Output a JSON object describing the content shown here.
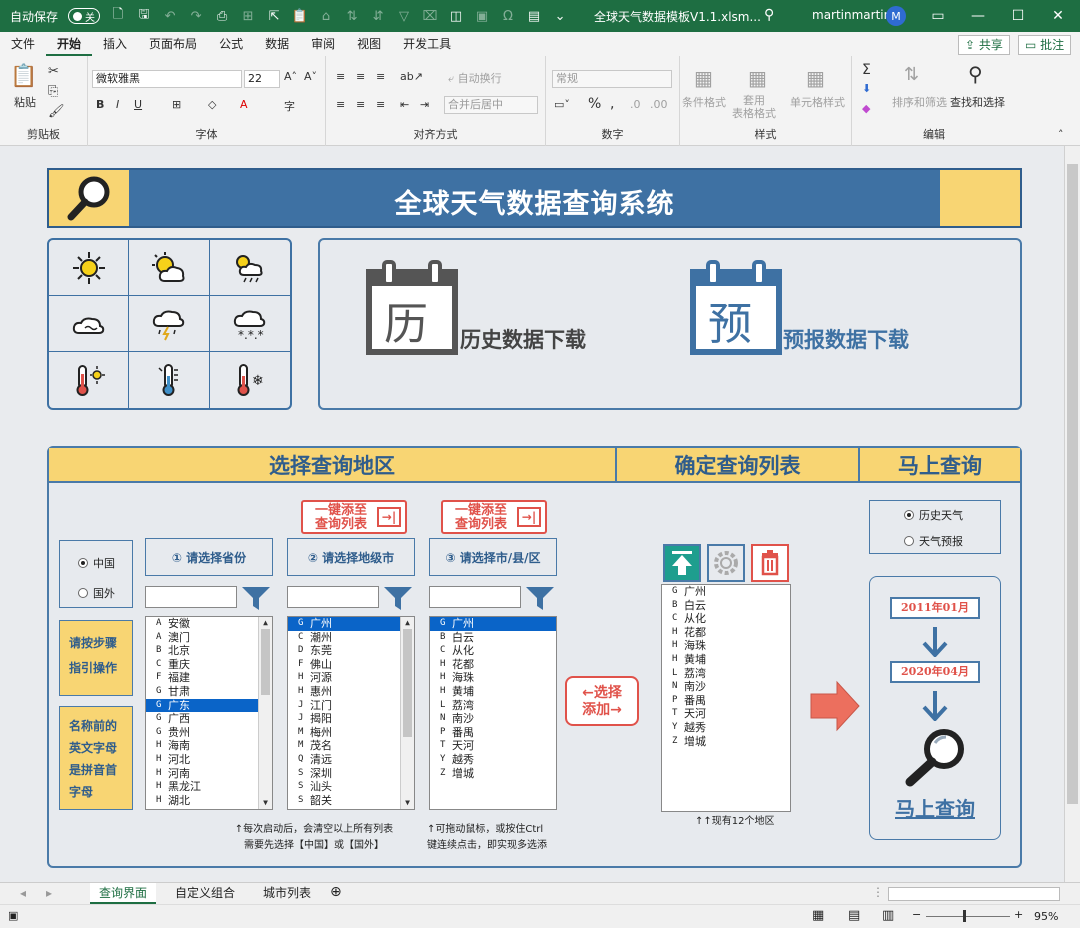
{
  "titlebar": {
    "autosave_label": "自动保存",
    "autosave_state": "关",
    "doc_title": "全球天气数据模板V1.1.xlsm...",
    "user_name": "martinmartin",
    "user_initial": "M"
  },
  "menu": {
    "items": [
      "文件",
      "开始",
      "插入",
      "页面布局",
      "公式",
      "数据",
      "审阅",
      "视图",
      "开发工具"
    ],
    "share_label": "共享",
    "comment_label": "批注"
  },
  "ribbon": {
    "clipboard": {
      "paste": "粘贴",
      "group": "剪贴板"
    },
    "font": {
      "name": "微软雅黑",
      "size": "22",
      "group": "字体"
    },
    "align": {
      "wrap": "自动换行",
      "merge": "合并后居中",
      "group": "对齐方式"
    },
    "number": {
      "format": "常规",
      "group": "数字"
    },
    "styles": {
      "cond": "条件格式",
      "table": "套用\n表格格式",
      "cell": "单元格样式",
      "group": "样式"
    },
    "edit": {
      "sort": "排序和筛选",
      "find": "查找和选择",
      "group": "编辑"
    }
  },
  "sheet": {
    "title": "全球天气数据查询系统",
    "history_icon_char": "历",
    "history_label": "历史数据下载",
    "forecast_icon_char": "预",
    "forecast_label": "预报数据下载",
    "hdr_region": "选择查询地区",
    "hdr_list": "确定查询列表",
    "hdr_query": "马上查询",
    "add_all_label": "一键添至\n查询列表",
    "region_options": {
      "china": "中国",
      "abroad": "国外"
    },
    "guide_box": "请按步骤\n指引操作",
    "pinyin_box": "名称前的\n英文字母\n是拼音首\n字母",
    "step1": "① 请选择省份",
    "step2": "② 请选择地级市",
    "step3": "③ 请选择市/县/区",
    "provinces": [
      {
        "k": "A",
        "n": "安徽"
      },
      {
        "k": "A",
        "n": "澳门"
      },
      {
        "k": "B",
        "n": "北京"
      },
      {
        "k": "C",
        "n": "重庆"
      },
      {
        "k": "F",
        "n": "福建"
      },
      {
        "k": "G",
        "n": "甘肃"
      },
      {
        "k": "G",
        "n": "广东",
        "sel": true
      },
      {
        "k": "G",
        "n": "广西"
      },
      {
        "k": "G",
        "n": "贵州"
      },
      {
        "k": "H",
        "n": "海南"
      },
      {
        "k": "H",
        "n": "河北"
      },
      {
        "k": "H",
        "n": "河南"
      },
      {
        "k": "H",
        "n": "黑龙江"
      },
      {
        "k": "H",
        "n": "湖北"
      }
    ],
    "cities": [
      {
        "k": "G",
        "n": "广州",
        "sel": true
      },
      {
        "k": "C",
        "n": "潮州"
      },
      {
        "k": "D",
        "n": "东莞"
      },
      {
        "k": "F",
        "n": "佛山"
      },
      {
        "k": "H",
        "n": "河源"
      },
      {
        "k": "H",
        "n": "惠州"
      },
      {
        "k": "J",
        "n": "江门"
      },
      {
        "k": "J",
        "n": "揭阳"
      },
      {
        "k": "M",
        "n": "梅州"
      },
      {
        "k": "M",
        "n": "茂名"
      },
      {
        "k": "Q",
        "n": "清远"
      },
      {
        "k": "S",
        "n": "深圳"
      },
      {
        "k": "S",
        "n": "汕头"
      },
      {
        "k": "S",
        "n": "韶关"
      }
    ],
    "districts": [
      {
        "k": "G",
        "n": "广州",
        "sel": true
      },
      {
        "k": "B",
        "n": "白云"
      },
      {
        "k": "C",
        "n": "从化"
      },
      {
        "k": "H",
        "n": "花都"
      },
      {
        "k": "H",
        "n": "海珠"
      },
      {
        "k": "H",
        "n": "黄埔"
      },
      {
        "k": "L",
        "n": "荔湾"
      },
      {
        "k": "N",
        "n": "南沙"
      },
      {
        "k": "P",
        "n": "番禺"
      },
      {
        "k": "T",
        "n": "天河"
      },
      {
        "k": "Y",
        "n": "越秀"
      },
      {
        "k": "Z",
        "n": "增城"
      }
    ],
    "note1": "↑每次启动后，会清空以上所有列表\n需要先选择【中国】或【国外】",
    "note2": "↑可拖动鼠标，或按住Ctrl\n键连续点击，即实现多选添",
    "select_add": "←选择\n添加→",
    "query_list": [
      {
        "k": "G",
        "n": "广州"
      },
      {
        "k": "B",
        "n": "白云"
      },
      {
        "k": "C",
        "n": "从化"
      },
      {
        "k": "H",
        "n": "花都"
      },
      {
        "k": "H",
        "n": "海珠"
      },
      {
        "k": "H",
        "n": "黄埔"
      },
      {
        "k": "L",
        "n": "荔湾"
      },
      {
        "k": "N",
        "n": "南沙"
      },
      {
        "k": "P",
        "n": "番禺"
      },
      {
        "k": "T",
        "n": "天河"
      },
      {
        "k": "Y",
        "n": "越秀"
      },
      {
        "k": "Z",
        "n": "增城"
      }
    ],
    "count_note": "↑↑现有12个地区",
    "mode_options": {
      "history": "历史天气",
      "forecast": "天气预报"
    },
    "start_date": "2011年01月",
    "end_date": "2020年04月",
    "query_now": "马上查询"
  },
  "tabs": {
    "items": [
      "查询界面",
      "自定义组合",
      "城市列表"
    ]
  },
  "status": {
    "zoom": "95%"
  },
  "colors": {
    "accent": "#3e71a3",
    "yellow": "#f8d573",
    "red": "#e0524a",
    "teal": "#1e9e8e",
    "excel_green": "#1e6e42"
  }
}
